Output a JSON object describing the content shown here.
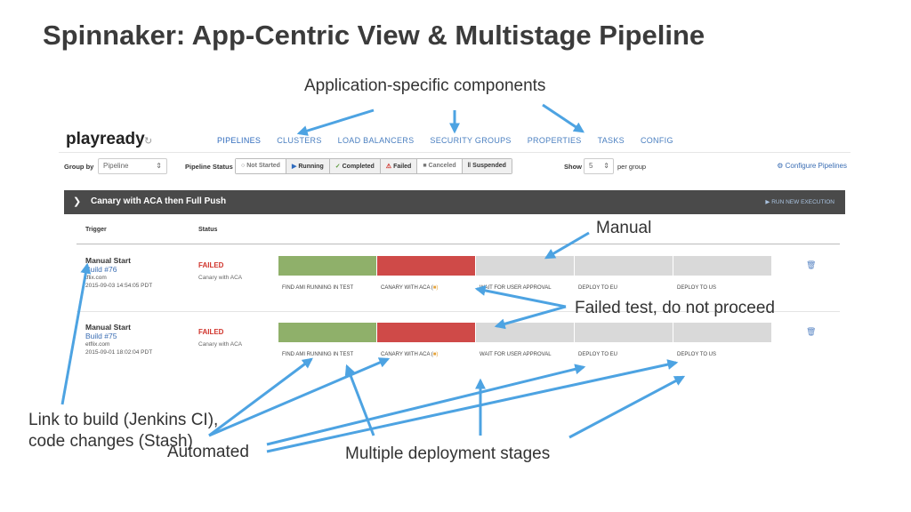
{
  "slide": {
    "title": "Spinnaker: App-Centric View & Multistage Pipeline",
    "callouts": {
      "components": "Application-specific components",
      "manual": "Manual",
      "failed": "Failed test, do not proceed",
      "link_line1": "Link to build (Jenkins CI),",
      "link_line2": "code changes (Stash)",
      "automated": "Automated",
      "stages": "Multiple deployment stages"
    },
    "arrow_color": "#4da3e2"
  },
  "app": {
    "name": "playready",
    "refresh_icon": "refresh-icon",
    "nav": [
      "PIPELINES",
      "CLUSTERS",
      "LOAD BALANCERS",
      "SECURITY GROUPS",
      "PROPERTIES",
      "TASKS",
      "CONFIG"
    ],
    "filters": {
      "group_by_label": "Group by",
      "group_by_value": "Pipeline",
      "pipeline_status_label": "Pipeline Status",
      "statuses": [
        {
          "icon": "○",
          "label": "Not Started"
        },
        {
          "icon": "▶",
          "label": "Running"
        },
        {
          "icon": "✓",
          "label": "Completed"
        },
        {
          "icon": "⚠",
          "label": "Failed"
        },
        {
          "icon": "■",
          "label": "Canceled"
        },
        {
          "icon": "‖",
          "label": "Suspended"
        }
      ],
      "show_label": "Show",
      "show_value": "5",
      "per_group": "per group",
      "configure": "Configure Pipelines"
    },
    "group": {
      "title": "Canary with ACA then Full Push",
      "run": "▶ RUN NEW EXECUTION"
    },
    "columns": {
      "trigger": "Trigger",
      "status": "Status"
    },
    "stage_names": [
      "FIND AMI RUNNING IN TEST",
      "CANARY WITH ACA (",
      "WAIT FOR USER APPROVAL",
      "DEPLOY TO EU",
      "DEPLOY TO US"
    ],
    "stage_colors": {
      "succeeded": "#8fb06a",
      "failed": "#cf4a48",
      "not_started": "#d9d9d9"
    },
    "executions": [
      {
        "trigger_title": "Manual Start",
        "build": "Build #76",
        "email": "tflix.com",
        "time": "2015-09-03 14:54:05 PDT",
        "status": "FAILED",
        "pipeline": "Canary with ACA",
        "stages": [
          "succeeded",
          "failed",
          "not_started",
          "not_started",
          "not_started"
        ]
      },
      {
        "trigger_title": "Manual Start",
        "build": "Build #75",
        "email": "etflix.com",
        "time": "2015-09-01 18:02:04 PDT",
        "status": "FAILED",
        "pipeline": "Canary with ACA",
        "stages": [
          "succeeded",
          "failed",
          "not_started",
          "not_started",
          "not_started"
        ]
      }
    ]
  }
}
